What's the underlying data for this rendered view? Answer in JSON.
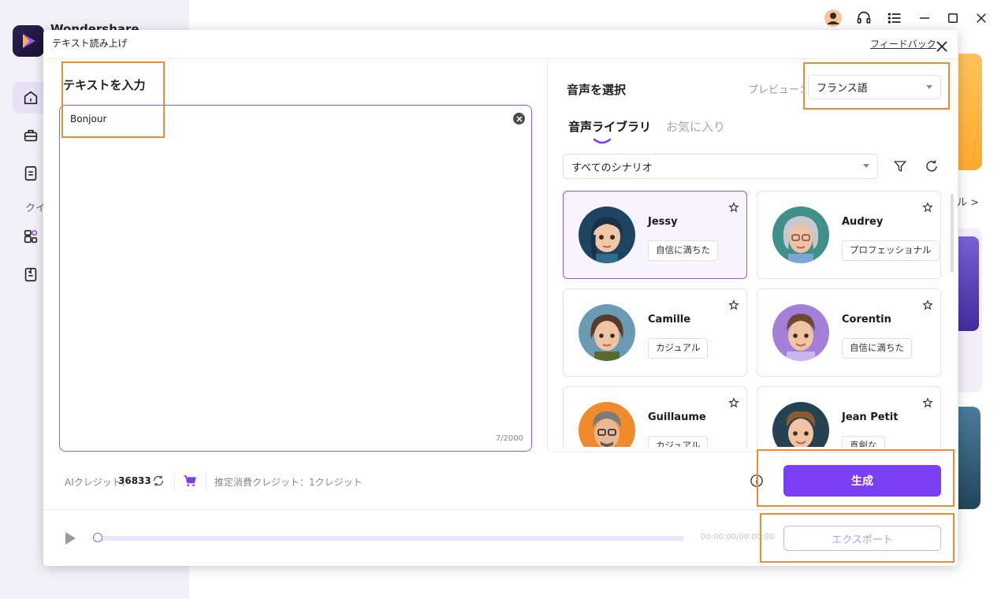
{
  "app": {
    "name": "Wondershare",
    "sidebar_label": "クイ"
  },
  "background": {
    "right_text": "ル >"
  },
  "dialog": {
    "title": "テキスト読み上げ",
    "feedback": "フィードバック"
  },
  "input": {
    "title": "テキストを入力",
    "value": "Bonjour",
    "char_count": "7/2000"
  },
  "voice": {
    "title": "音声を選択",
    "preview_label": "プレビュー：",
    "language": "フランス語",
    "tabs": {
      "library": "音声ライブラリ",
      "favorites": "お気に入り"
    },
    "scenario": "すべてのシナリオ",
    "items": [
      {
        "name": "Jessy",
        "tag": "自信に満ちた",
        "selected": true
      },
      {
        "name": "Audrey",
        "tag": "プロフェッショナル",
        "selected": false
      },
      {
        "name": "Camille",
        "tag": "カジュアル",
        "selected": false
      },
      {
        "name": "Corentin",
        "tag": "自信に満ちた",
        "selected": false
      },
      {
        "name": "Guillaume",
        "tag": "カジュアル",
        "selected": false
      },
      {
        "name": "Jean Petit",
        "tag": "真剣な",
        "selected": false
      }
    ]
  },
  "credits": {
    "label": "AIクレジット：",
    "value": "36833",
    "estimate": "推定消費クレジット：1クレジット"
  },
  "actions": {
    "generate": "生成",
    "export": "エクスポート"
  },
  "player": {
    "time": "00:00:00/00:00:00",
    "progress": 0
  },
  "colors": {
    "accent": "#7a3ff2",
    "highlight": "#f08a33",
    "selected_bg": "#f7f4ff"
  }
}
